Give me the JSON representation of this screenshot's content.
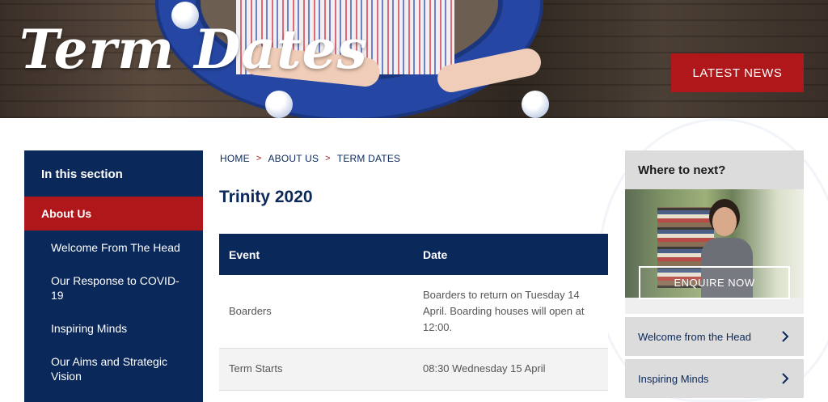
{
  "hero": {
    "title": "Term Dates",
    "latest_news_label": "LATEST NEWS"
  },
  "sidebar": {
    "heading": "In this section",
    "active_item": "About Us",
    "items": [
      {
        "label": "Welcome From The Head"
      },
      {
        "label": "Our Response to COVID-19"
      },
      {
        "label": "Inspiring Minds"
      },
      {
        "label": "Our Aims and Strategic Vision"
      }
    ]
  },
  "breadcrumb": {
    "items": [
      "HOME",
      "ABOUT US",
      "TERM DATES"
    ],
    "separator": ">"
  },
  "main": {
    "title": "Trinity 2020",
    "table": {
      "headers": [
        "Event",
        "Date"
      ],
      "rows": [
        {
          "event": "Boarders",
          "date": "Boarders to return on Tuesday 14 April. Boarding houses will open at 12:00."
        },
        {
          "event": "Term Starts",
          "date": "08:30 Wednesday 15 April"
        }
      ]
    }
  },
  "where_next": {
    "heading": "Where to next?",
    "enquire_label": "ENQUIRE NOW",
    "links": [
      {
        "label": "Welcome from the Head"
      },
      {
        "label": "Inspiring Minds"
      }
    ]
  },
  "colors": {
    "navy": "#0a2859",
    "red": "#b0171a",
    "light_grey": "#dcdcdc"
  },
  "icons": [
    "chevron-right-icon"
  ]
}
